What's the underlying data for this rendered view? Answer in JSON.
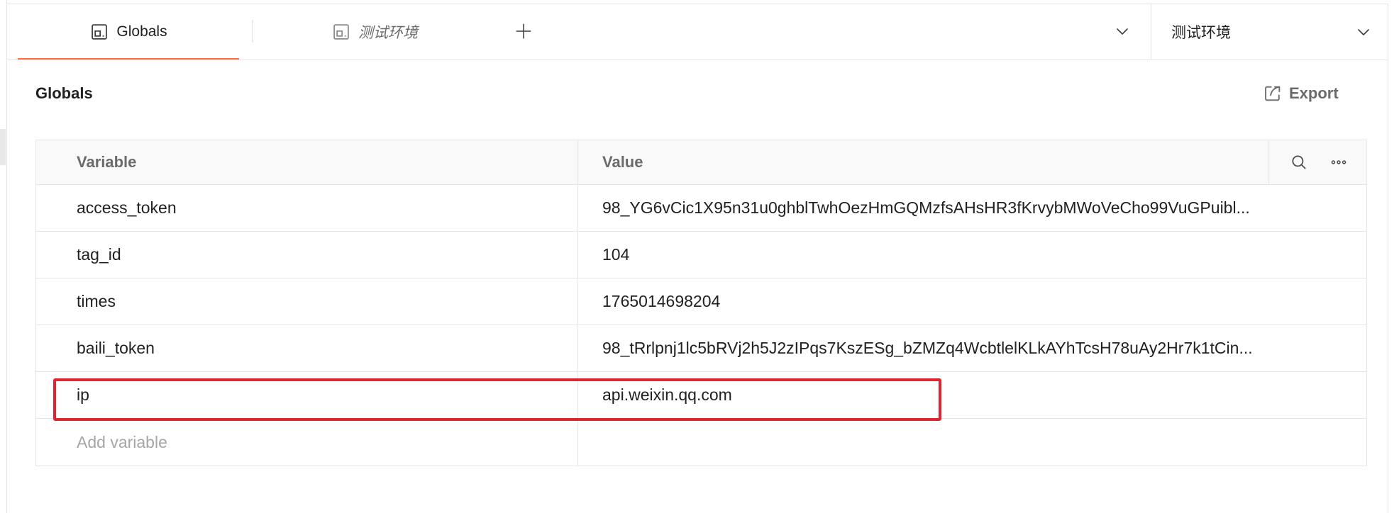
{
  "tabs": [
    {
      "label": "Globals",
      "icon": "globals-icon",
      "active": true
    },
    {
      "label": "测试环境",
      "icon": "environment-icon",
      "active": false
    }
  ],
  "environment_selector": {
    "selected": "测试环境"
  },
  "page": {
    "title": "Globals",
    "export_label": "Export"
  },
  "table": {
    "columns": [
      "Variable",
      "Value"
    ],
    "rows": [
      {
        "variable": "access_token",
        "value": "98_YG6vCic1X95n31u0ghblTwhOezHmGQMzfsAHsHR3fKrvybMWoVeCho99VuGPuibl..."
      },
      {
        "variable": "tag_id",
        "value": "104"
      },
      {
        "variable": "times",
        "value": "1765014698204"
      },
      {
        "variable": "baili_token",
        "value": "98_tRrlpnj1lc5bRVj2h5J2zIPqs7KszESg_bZMZq4WcbtlelKLkAYhTcsH78uAy2Hr7k1tCin..."
      },
      {
        "variable": "ip",
        "value": "api.weixin.qq.com"
      }
    ],
    "add_placeholder": "Add variable"
  },
  "icons": [
    "globals-icon",
    "environment-icon",
    "plus-icon",
    "chevron-down-icon",
    "export-icon",
    "search-icon",
    "more-icon"
  ],
  "colors": {
    "accent": "#ff6c37",
    "highlight": "#e0242d",
    "text": "#212121",
    "muted": "#6b6b6b"
  }
}
